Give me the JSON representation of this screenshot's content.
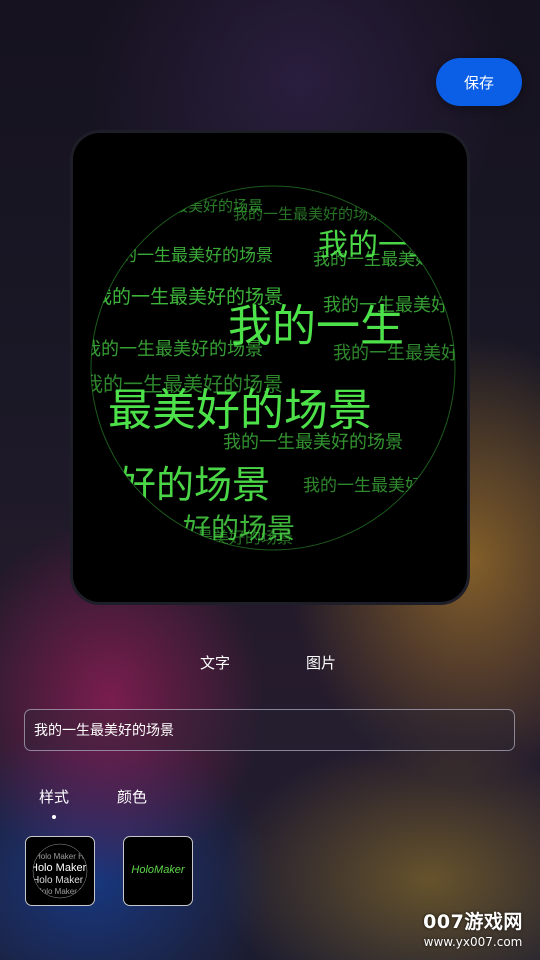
{
  "header": {
    "save_label": "保存"
  },
  "preview": {
    "sphere_text": "我的一生最美好的场景",
    "text_color": "#4ee24a",
    "headline_1": "我的一生",
    "headline_2": "最美好的场景",
    "headline_3": "好的场景",
    "headline_4": "好的场景"
  },
  "tabs": {
    "text_label": "文字",
    "image_label": "图片"
  },
  "input": {
    "value": "我的一生最美好的场景"
  },
  "subtabs": {
    "style_label": "样式",
    "color_label": "颜色"
  },
  "thumbnails": {
    "style_sample_text": "Holo Maker Holo",
    "color_sample_text": "HoloMaker"
  },
  "watermark": {
    "brand": "007游戏网",
    "url": "www.yx007.com"
  },
  "colors": {
    "accent": "#0b5fe6",
    "hologram_green": "#4ee24a"
  }
}
